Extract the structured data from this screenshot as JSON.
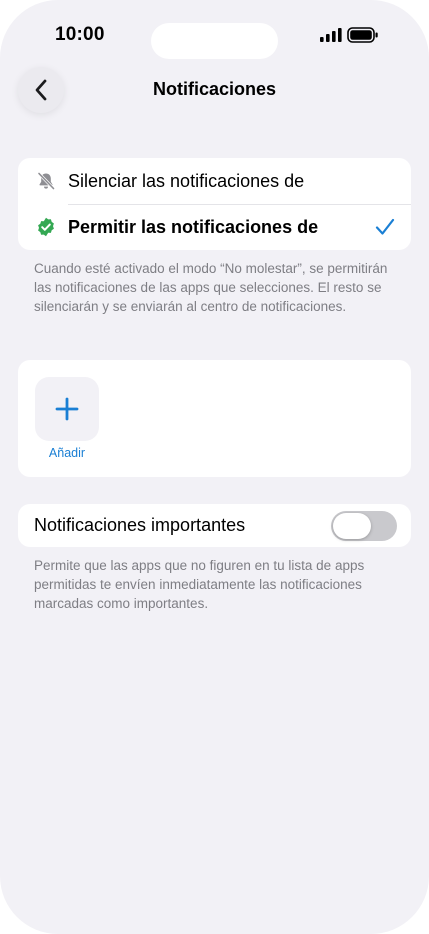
{
  "status_bar": {
    "time": "10:00",
    "signal_icon": "cellular-signal-icon",
    "battery_icon": "battery-icon"
  },
  "nav": {
    "back_icon": "chevron-left-icon",
    "title": "Notificaciones"
  },
  "mode_options": [
    {
      "icon": "bell-slash-icon",
      "label": "Silenciar las notificaciones de",
      "selected": false
    },
    {
      "icon": "verified-check-badge-icon",
      "label": "Permitir las notificaciones de",
      "selected": true
    }
  ],
  "mode_note": "Cuando esté activado el modo “No molestar”, se permitirán las notificaciones de las apps que selecciones. El resto se silenciarán y se enviarán al centro de notificaciones.",
  "apps": {
    "add_icon": "plus-icon",
    "add_label": "Añadir"
  },
  "important": {
    "label": "Notificaciones importantes",
    "enabled": false,
    "note": "Permite que las apps que no figuren en tu lista de apps permitidas te envíen inmediatamente las notificaciones marcadas como importantes."
  },
  "colors": {
    "accent": "#1a7fd4",
    "background": "#f2f1f6",
    "verified_green": "#34a853",
    "toggle_off": "#c9c9cd"
  }
}
